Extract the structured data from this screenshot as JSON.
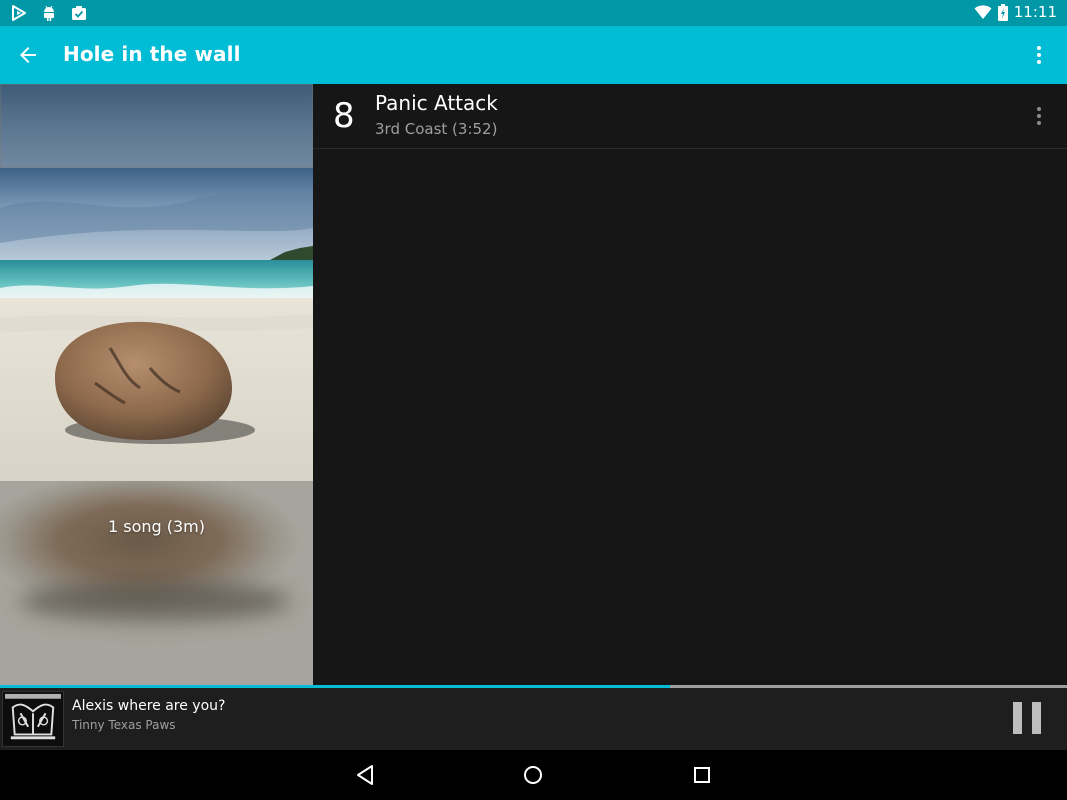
{
  "status_bar": {
    "time": "11:11",
    "icons": [
      "play-store-icon",
      "android-icon",
      "clipboard-check-icon",
      "wifi-icon",
      "battery-icon"
    ],
    "color": "#0097a7"
  },
  "app_bar": {
    "title": "Hole in the wall",
    "color": "#00bcd4",
    "icons": [
      "back-arrow-icon",
      "overflow-menu-icon"
    ]
  },
  "album": {
    "song_count": "1 song (3m)"
  },
  "tracks": [
    {
      "number": "8",
      "title": "Panic Attack",
      "subtitle": "3rd Coast (3:52)"
    }
  ],
  "playback": {
    "progress": 0.628,
    "accent": "#00bcd4"
  },
  "now_playing": {
    "title": "Alexis where are you?",
    "artist": "Tinny Texas Paws",
    "control": "pause-icon"
  },
  "nav_bar": {
    "buttons": [
      "back-nav-icon",
      "home-nav-icon",
      "recents-nav-icon"
    ]
  }
}
